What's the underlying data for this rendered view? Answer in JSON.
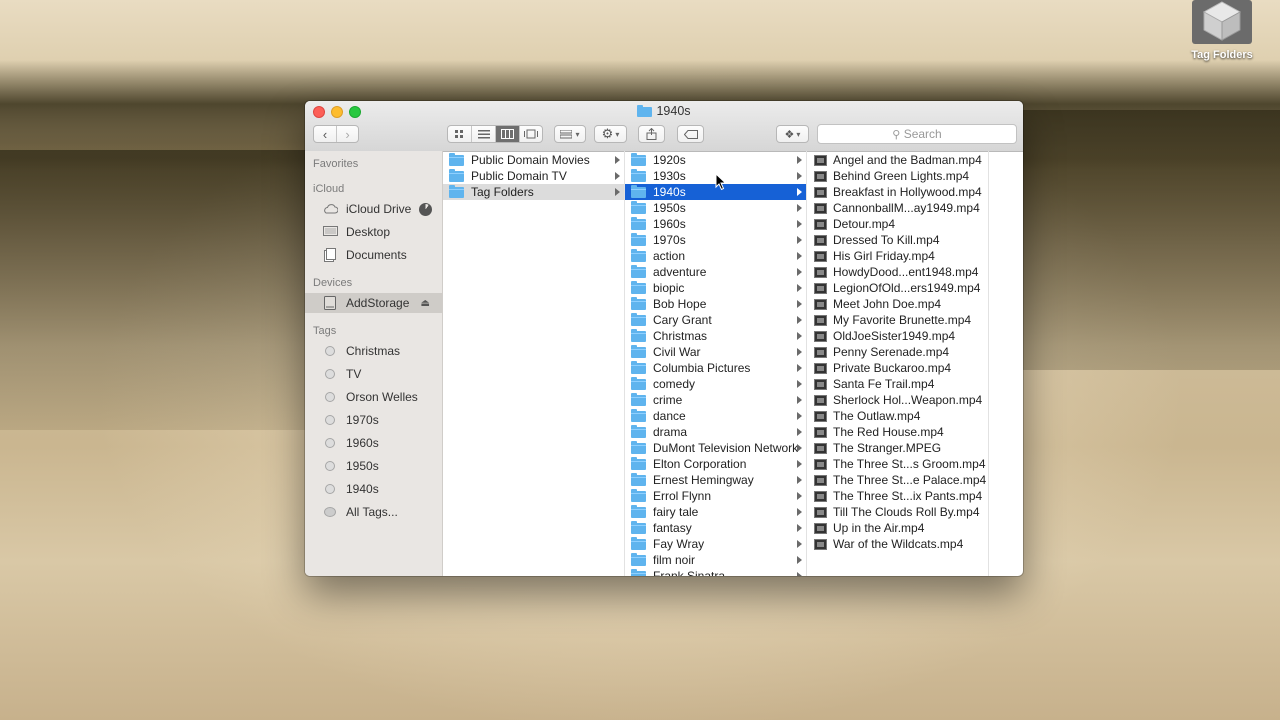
{
  "desktop": {
    "icon_label": "Tag Folders"
  },
  "window": {
    "title": "1940s",
    "search_placeholder": "Search"
  },
  "sidebar": {
    "sections": [
      {
        "heading": "Favorites",
        "items": []
      },
      {
        "heading": "iCloud",
        "items": [
          {
            "label": "iCloud Drive",
            "icon": "cloud-icon"
          },
          {
            "label": "Desktop",
            "icon": "desktop-icon"
          },
          {
            "label": "Documents",
            "icon": "documents-icon"
          }
        ]
      },
      {
        "heading": "Devices",
        "items": [
          {
            "label": "AddStorage",
            "icon": "drive-icon",
            "selected": true
          }
        ]
      },
      {
        "heading": "Tags",
        "items": [
          {
            "label": "Christmas"
          },
          {
            "label": "TV"
          },
          {
            "label": "Orson Welles"
          },
          {
            "label": "1970s"
          },
          {
            "label": "1960s"
          },
          {
            "label": "1950s"
          },
          {
            "label": "1940s"
          },
          {
            "label": "All Tags..."
          }
        ]
      }
    ]
  },
  "column1": [
    {
      "label": "Public Domain Movies"
    },
    {
      "label": "Public Domain TV"
    },
    {
      "label": "Tag Folders",
      "state": "path"
    }
  ],
  "column2": [
    {
      "label": "1920s"
    },
    {
      "label": "1930s"
    },
    {
      "label": "1940s",
      "state": "selected"
    },
    {
      "label": "1950s"
    },
    {
      "label": "1960s"
    },
    {
      "label": "1970s"
    },
    {
      "label": "action"
    },
    {
      "label": "adventure"
    },
    {
      "label": "biopic"
    },
    {
      "label": "Bob Hope"
    },
    {
      "label": "Cary Grant"
    },
    {
      "label": "Christmas"
    },
    {
      "label": "Civil War"
    },
    {
      "label": "Columbia Pictures"
    },
    {
      "label": "comedy"
    },
    {
      "label": "crime"
    },
    {
      "label": "dance"
    },
    {
      "label": "drama"
    },
    {
      "label": "DuMont Television Network"
    },
    {
      "label": "Elton Corporation"
    },
    {
      "label": "Ernest Hemingway"
    },
    {
      "label": "Errol Flynn"
    },
    {
      "label": "fairy tale"
    },
    {
      "label": "fantasy"
    },
    {
      "label": "Fay Wray"
    },
    {
      "label": "film noir"
    },
    {
      "label": "Frank Sinatra"
    }
  ],
  "column3": [
    {
      "label": "Angel and the Badman.mp4"
    },
    {
      "label": "Behind Green Lights.mp4"
    },
    {
      "label": "Breakfast in Hollywood.mp4"
    },
    {
      "label": "CannonballM...ay1949.mp4"
    },
    {
      "label": "Detour.mp4"
    },
    {
      "label": "Dressed To Kill.mp4"
    },
    {
      "label": "His Girl Friday.mp4"
    },
    {
      "label": "HowdyDood...ent1948.mp4"
    },
    {
      "label": "LegionOfOld...ers1949.mp4"
    },
    {
      "label": "Meet John Doe.mp4"
    },
    {
      "label": "My Favorite Brunette.mp4"
    },
    {
      "label": "OldJoeSister1949.mp4"
    },
    {
      "label": "Penny Serenade.mp4"
    },
    {
      "label": "Private Buckaroo.mp4"
    },
    {
      "label": "Santa Fe Trail.mp4"
    },
    {
      "label": "Sherlock Hol...Weapon.mp4"
    },
    {
      "label": "The Outlaw.mp4"
    },
    {
      "label": "The Red House.mp4"
    },
    {
      "label": "The Stranger.MPEG"
    },
    {
      "label": "The Three St...s Groom.mp4"
    },
    {
      "label": "The Three St...e Palace.mp4"
    },
    {
      "label": "The Three St...ix Pants.mp4"
    },
    {
      "label": "Till The Clouds Roll By.mp4"
    },
    {
      "label": "Up in the Air.mp4"
    },
    {
      "label": "War of the Wildcats.mp4"
    }
  ],
  "colors": {
    "selection": "#1661d6",
    "folder": "#5fb4ee"
  }
}
